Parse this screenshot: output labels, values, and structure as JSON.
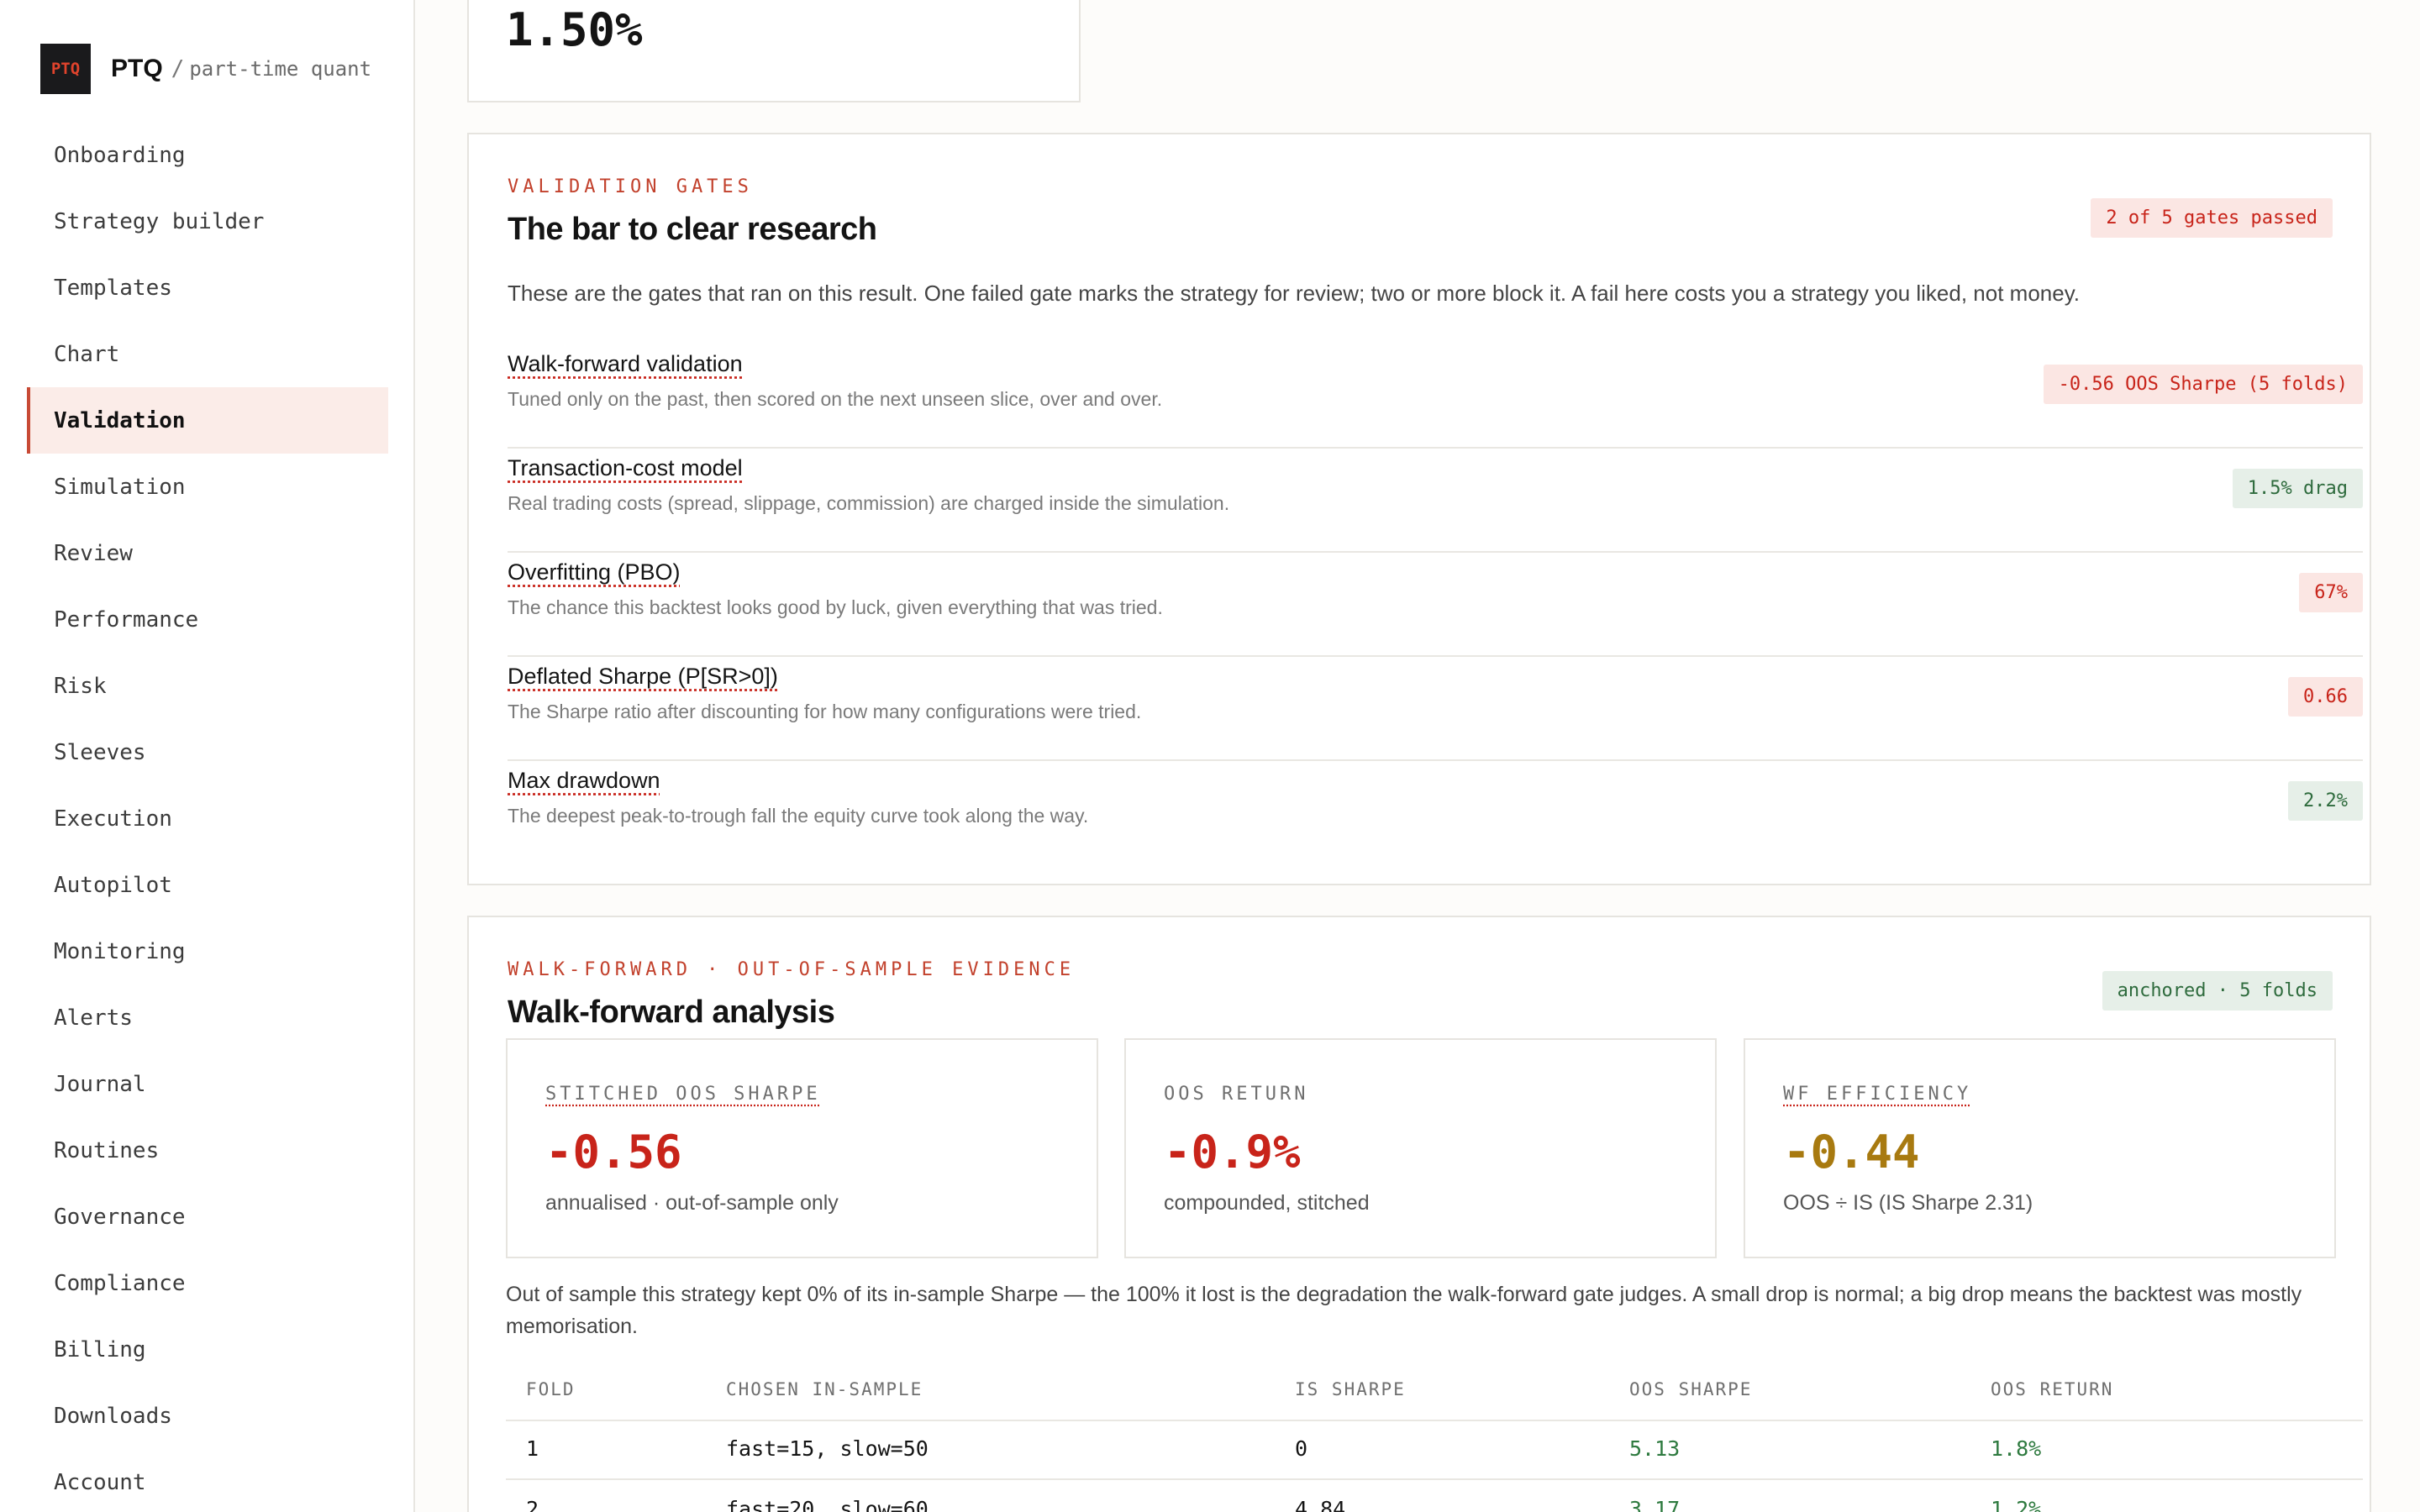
{
  "brand": {
    "logo": "PTQ",
    "name": "PTQ",
    "separator": "/",
    "tagline": "part-time quant"
  },
  "nav": {
    "items": [
      "Onboarding",
      "Strategy builder",
      "Templates",
      "Chart",
      "Validation",
      "Simulation",
      "Review",
      "Performance",
      "Risk",
      "Sleeves",
      "Execution",
      "Autopilot",
      "Monitoring",
      "Alerts",
      "Journal",
      "Routines",
      "Governance",
      "Compliance",
      "Billing",
      "Downloads",
      "Account"
    ],
    "active": "Validation"
  },
  "top_card": {
    "value": "1.50%"
  },
  "validation": {
    "eyebrow": "VALIDATION GATES",
    "title": "The bar to clear research",
    "badge": "2 of 5 gates passed",
    "intro": "These are the gates that ran on this result. One failed gate marks the strategy for review; two or more block it. A fail here costs you a strategy you liked, not money.",
    "gates": [
      {
        "name": "Walk-forward validation",
        "desc": "Tuned only on the past, then scored on the next unseen slice, over and over.",
        "result": "-0.56 OOS Sharpe (5 folds)",
        "status": "fail"
      },
      {
        "name": "Transaction-cost model",
        "desc": "Real trading costs (spread, slippage, commission) are charged inside the simulation.",
        "result": "1.5% drag",
        "status": "pass"
      },
      {
        "name": "Overfitting (PBO)",
        "desc": "The chance this backtest looks good by luck, given everything that was tried.",
        "result": "67%",
        "status": "fail"
      },
      {
        "name": "Deflated Sharpe (P[SR>0])",
        "desc": "The Sharpe ratio after discounting for how many configurations were tried.",
        "result": "0.66",
        "status": "fail"
      },
      {
        "name": "Max drawdown",
        "desc": "The deepest peak-to-trough fall the equity curve took along the way.",
        "result": "2.2%",
        "status": "pass"
      }
    ]
  },
  "walkforward": {
    "eyebrow": "WALK-FORWARD · OUT-OF-SAMPLE EVIDENCE",
    "title": "Walk-forward analysis",
    "badge": "anchored · 5 folds",
    "metrics": [
      {
        "label": "STITCHED OOS SHARPE",
        "value": "-0.56",
        "sub": "annualised · out-of-sample only",
        "color": "#c8241a"
      },
      {
        "label": "OOS RETURN",
        "value": "-0.9%",
        "sub": "compounded, stitched",
        "color": "#c8241a"
      },
      {
        "label": "WF EFFICIENCY",
        "value": "-0.44",
        "sub": "OOS ÷ IS (IS Sharpe 2.31)",
        "color": "#a87a10"
      }
    ],
    "summary": "Out of sample this strategy kept 0% of its in-sample Sharpe — the 100% it lost is the degradation the walk-forward gate judges. A small drop is normal; a big drop means the backtest was mostly memorisation.",
    "table": {
      "headers": [
        "FOLD",
        "CHOSEN IN-SAMPLE",
        "IS SHARPE",
        "OOS SHARPE",
        "OOS RETURN"
      ],
      "rows": [
        [
          "1",
          "fast=15, slow=50",
          "0",
          "5.13",
          "1.8%"
        ],
        [
          "2",
          "fast=20, slow=60",
          "4.84",
          "3.17",
          "1.2%"
        ]
      ]
    }
  },
  "colors": {
    "accent": "#c2412c",
    "fail": "#c8241a",
    "pass": "#2e6b3d",
    "warn": "#a87a10"
  }
}
